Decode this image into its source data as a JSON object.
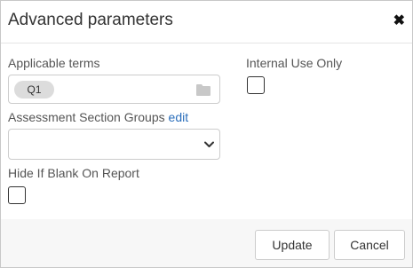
{
  "dialog": {
    "title": "Advanced parameters",
    "close_label": "✖"
  },
  "applicable_terms": {
    "label": "Applicable terms",
    "chip": "Q1",
    "icon": "folder-icon"
  },
  "internal_use": {
    "label": "Internal Use Only",
    "checked": false
  },
  "assessment_groups": {
    "label": "Assessment Section Groups",
    "edit_link": "edit",
    "selected_value": ""
  },
  "hide_if_blank": {
    "label": "Hide If Blank On Report",
    "checked": false
  },
  "footer": {
    "update_label": "Update",
    "cancel_label": "Cancel"
  }
}
